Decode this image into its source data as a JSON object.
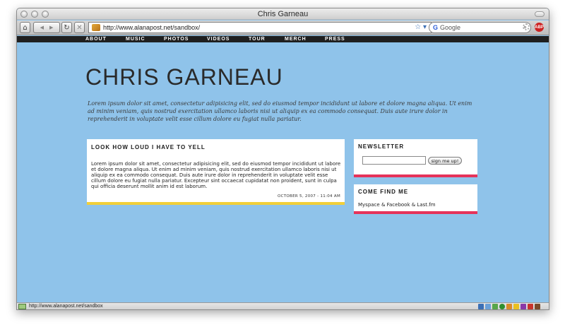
{
  "window": {
    "title": "Chris Garneau"
  },
  "toolbar": {
    "url": "http://www.alanapost.net/sandbox/",
    "search_placeholder": "Google",
    "search_engine_letter": "G",
    "abp_label": "ABP",
    "back_glyph": "◀",
    "forward_glyph": "▶",
    "reload_glyph": "↻",
    "stop_glyph": "✕",
    "home_glyph": "⌂",
    "star_glyph": "☆ ▾",
    "mag_glyph": "🔍"
  },
  "nav": {
    "items": [
      "ABOUT",
      "MUSIC",
      "PHOTOS",
      "VIDEOS",
      "TOUR",
      "MERCH",
      "PRESS"
    ]
  },
  "site": {
    "title": "CHRIS GARNEAU",
    "intro": "Lorem ipsum dolor sit amet, consectetur adipisicing elit, sed do eiusmod tempor incididunt ut labore et dolore magna aliqua. Ut enim ad minim veniam, quis nostrud exercitation ullamco laboris nisi ut aliquip ex ea commodo consequat. Duis aute irure dolor in reprehenderit in voluptate velit esse cillum dolore eu fugiat nulla pariatur."
  },
  "post": {
    "title": "LOOK HOW LOUD I HAVE TO YELL",
    "body": "Lorem ipsum dolor sit amet, consectetur adipisicing elit, sed do eiusmod tempor incididunt ut labore et dolore magna aliqua. Ut enim ad minim veniam, quis nostrud exercitation ullamco laboris nisi ut aliquip ex ea commodo consequat. Duis aute irure dolor in reprehenderit in voluptate velit esse cillum dolore eu fugiat nulla pariatur. Excepteur sint occaecat cupidatat non proident, sunt in culpa qui officia deserunt mollit anim id est laborum.",
    "date": "OCTOBER 5, 2007 - 11:04 AM"
  },
  "newsletter": {
    "title": "NEWSLETTER",
    "input_value": "",
    "button_label": "sign me up!"
  },
  "findme": {
    "title": "COME FIND ME",
    "links": "Myspace & Facebook & Last.fm"
  },
  "status": {
    "text": "http://www.alanapost.net/sandbox"
  },
  "colors": {
    "page_bg": "#8fc3ea",
    "post_accent": "#f1cf3a",
    "widget_accent": "#e5335a",
    "nav_bg": "#1f1f1f"
  }
}
